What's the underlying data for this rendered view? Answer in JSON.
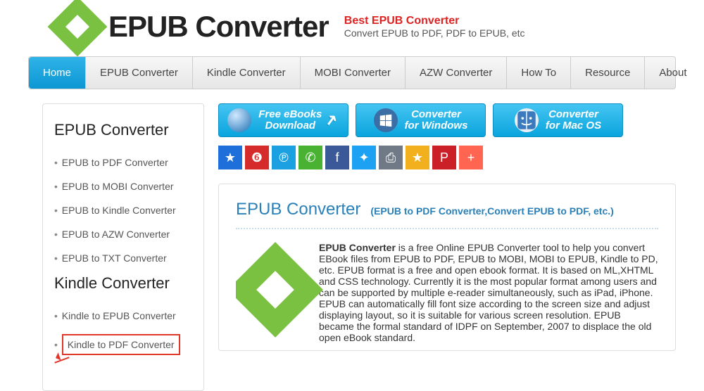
{
  "header": {
    "site_name": "EPUB Converter",
    "slogan_title": "Best EPUB Converter",
    "slogan_sub": "Convert EPUB to PDF, PDF to EPUB, etc"
  },
  "nav": {
    "items": [
      "Home",
      "EPUB Converter",
      "Kindle Converter",
      "MOBI Converter",
      "AZW Converter",
      "How To",
      "Resource",
      "About"
    ],
    "active_index": 0
  },
  "sidebar": {
    "sections": [
      {
        "title": "EPUB Converter",
        "items": [
          "EPUB to PDF Converter",
          "EPUB to MOBI Converter",
          "EPUB to Kindle Converter",
          "EPUB to AZW Converter",
          "EPUB to TXT Converter"
        ]
      },
      {
        "title": "Kindle Converter",
        "items": [
          "Kindle to EPUB Converter",
          "Kindle to PDF Converter"
        ],
        "highlight_index": 1
      }
    ]
  },
  "cta": [
    {
      "line1": "Free eBooks",
      "line2": "Download",
      "icon": "globe"
    },
    {
      "line1": "Converter",
      "line2": "for Windows",
      "icon": "windows"
    },
    {
      "line1": "Converter",
      "line2": "for Mac OS",
      "icon": "mac"
    }
  ],
  "share": [
    {
      "name": "qzone",
      "bg": "#1e6fd9",
      "glyph": "★"
    },
    {
      "name": "weibo",
      "bg": "#d52b2b",
      "glyph": "❻"
    },
    {
      "name": "baidu",
      "bg": "#1ba0e1",
      "glyph": "℗"
    },
    {
      "name": "wechat",
      "bg": "#49b233",
      "glyph": "✆"
    },
    {
      "name": "facebook",
      "bg": "#3b5998",
      "glyph": "f"
    },
    {
      "name": "twitter",
      "bg": "#1da1f2",
      "glyph": "✦"
    },
    {
      "name": "print",
      "bg": "#6f7a86",
      "glyph": "⎙"
    },
    {
      "name": "addfav",
      "bg": "#f2b01e",
      "glyph": "★"
    },
    {
      "name": "pinterest",
      "bg": "#cb2027",
      "glyph": "P"
    },
    {
      "name": "more",
      "bg": "#ff6550",
      "glyph": "+"
    }
  ],
  "content": {
    "title": "EPUB Converter",
    "subtitle": "(EPUB to PDF Converter,Convert EPUB to PDF, etc.)",
    "body_strong": "EPUB Converter",
    "body_rest": " is a free Online EPUB Converter tool to help you convert EBook files from EPUB to PDF, EPUB to MOBI, MOBI to EPUB, Kindle to PD, etc. EPUB format is a free and open ebook format. It is based on ML,XHTML and CSS technology. Currently it is the most popular format among users and can be supported by multiple e-reader simultaneously, such as iPad, iPhone. EPUB can automatically fill font size according to the screen size and adjust displaying layout, so it is suitable for various screen resolution. EPUB became the formal standard of IDPF on September, 2007 to displace the old open eBook standard."
  }
}
